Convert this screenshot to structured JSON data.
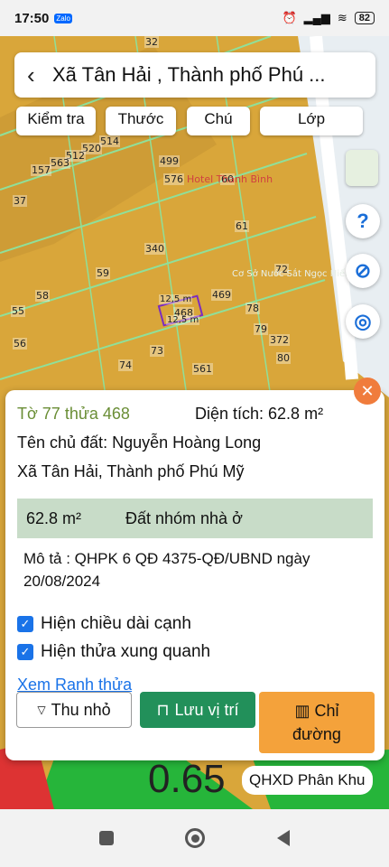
{
  "status": {
    "time": "17:50",
    "app_badge": "Zalo",
    "battery": "82"
  },
  "header": {
    "back_icon": "chevron-left-icon",
    "title": "Xã Tân Hải , Thành phố Phú ..."
  },
  "toolbar": {
    "chips": [
      "Kiểm tra",
      "Thước",
      "Chú",
      "Lớp"
    ]
  },
  "map": {
    "plot_numbers": [
      "32",
      "514",
      "520",
      "512",
      "563",
      "157",
      "499",
      "576",
      "60",
      "37",
      "61",
      "340",
      "59",
      "72",
      "58",
      "469",
      "55",
      "468",
      "78",
      "56",
      "73",
      "79",
      "372",
      "74",
      "80",
      "561"
    ],
    "selected_edge_labels": [
      "12,5 m",
      "12,5 m"
    ],
    "poi": "Hotel Thanh Bình",
    "poi2": "Cơ Sở Nước Sắt Ngọc Hiếu",
    "tag": "QHXD Phân Khu",
    "big_value": "0.65"
  },
  "sheet": {
    "parcel_id": "Tờ 77 thửa 468",
    "area_label": "Diện tích: 62.8 m²",
    "owner": "Tên chủ đất: Nguyễn Hoàng Long",
    "address": "Xã Tân Hải, Thành phố Phú Mỹ",
    "land_area": "62.8 m²",
    "land_type": "Đất nhóm nhà ở",
    "description": "Mô tả : QHPK 6 QĐ 4375-QĐ/UBND ngày 20/08/2024",
    "checkbox_1": "Hiện chiều dài cạnh",
    "checkbox_2": "Hiện thửa xung quanh",
    "link": "Xem Ranh thửa",
    "btn_shrink": "Thu nhỏ",
    "btn_save": "Lưu vị trí",
    "btn_dir_1": "Chỉ",
    "btn_dir_2": "đường"
  }
}
